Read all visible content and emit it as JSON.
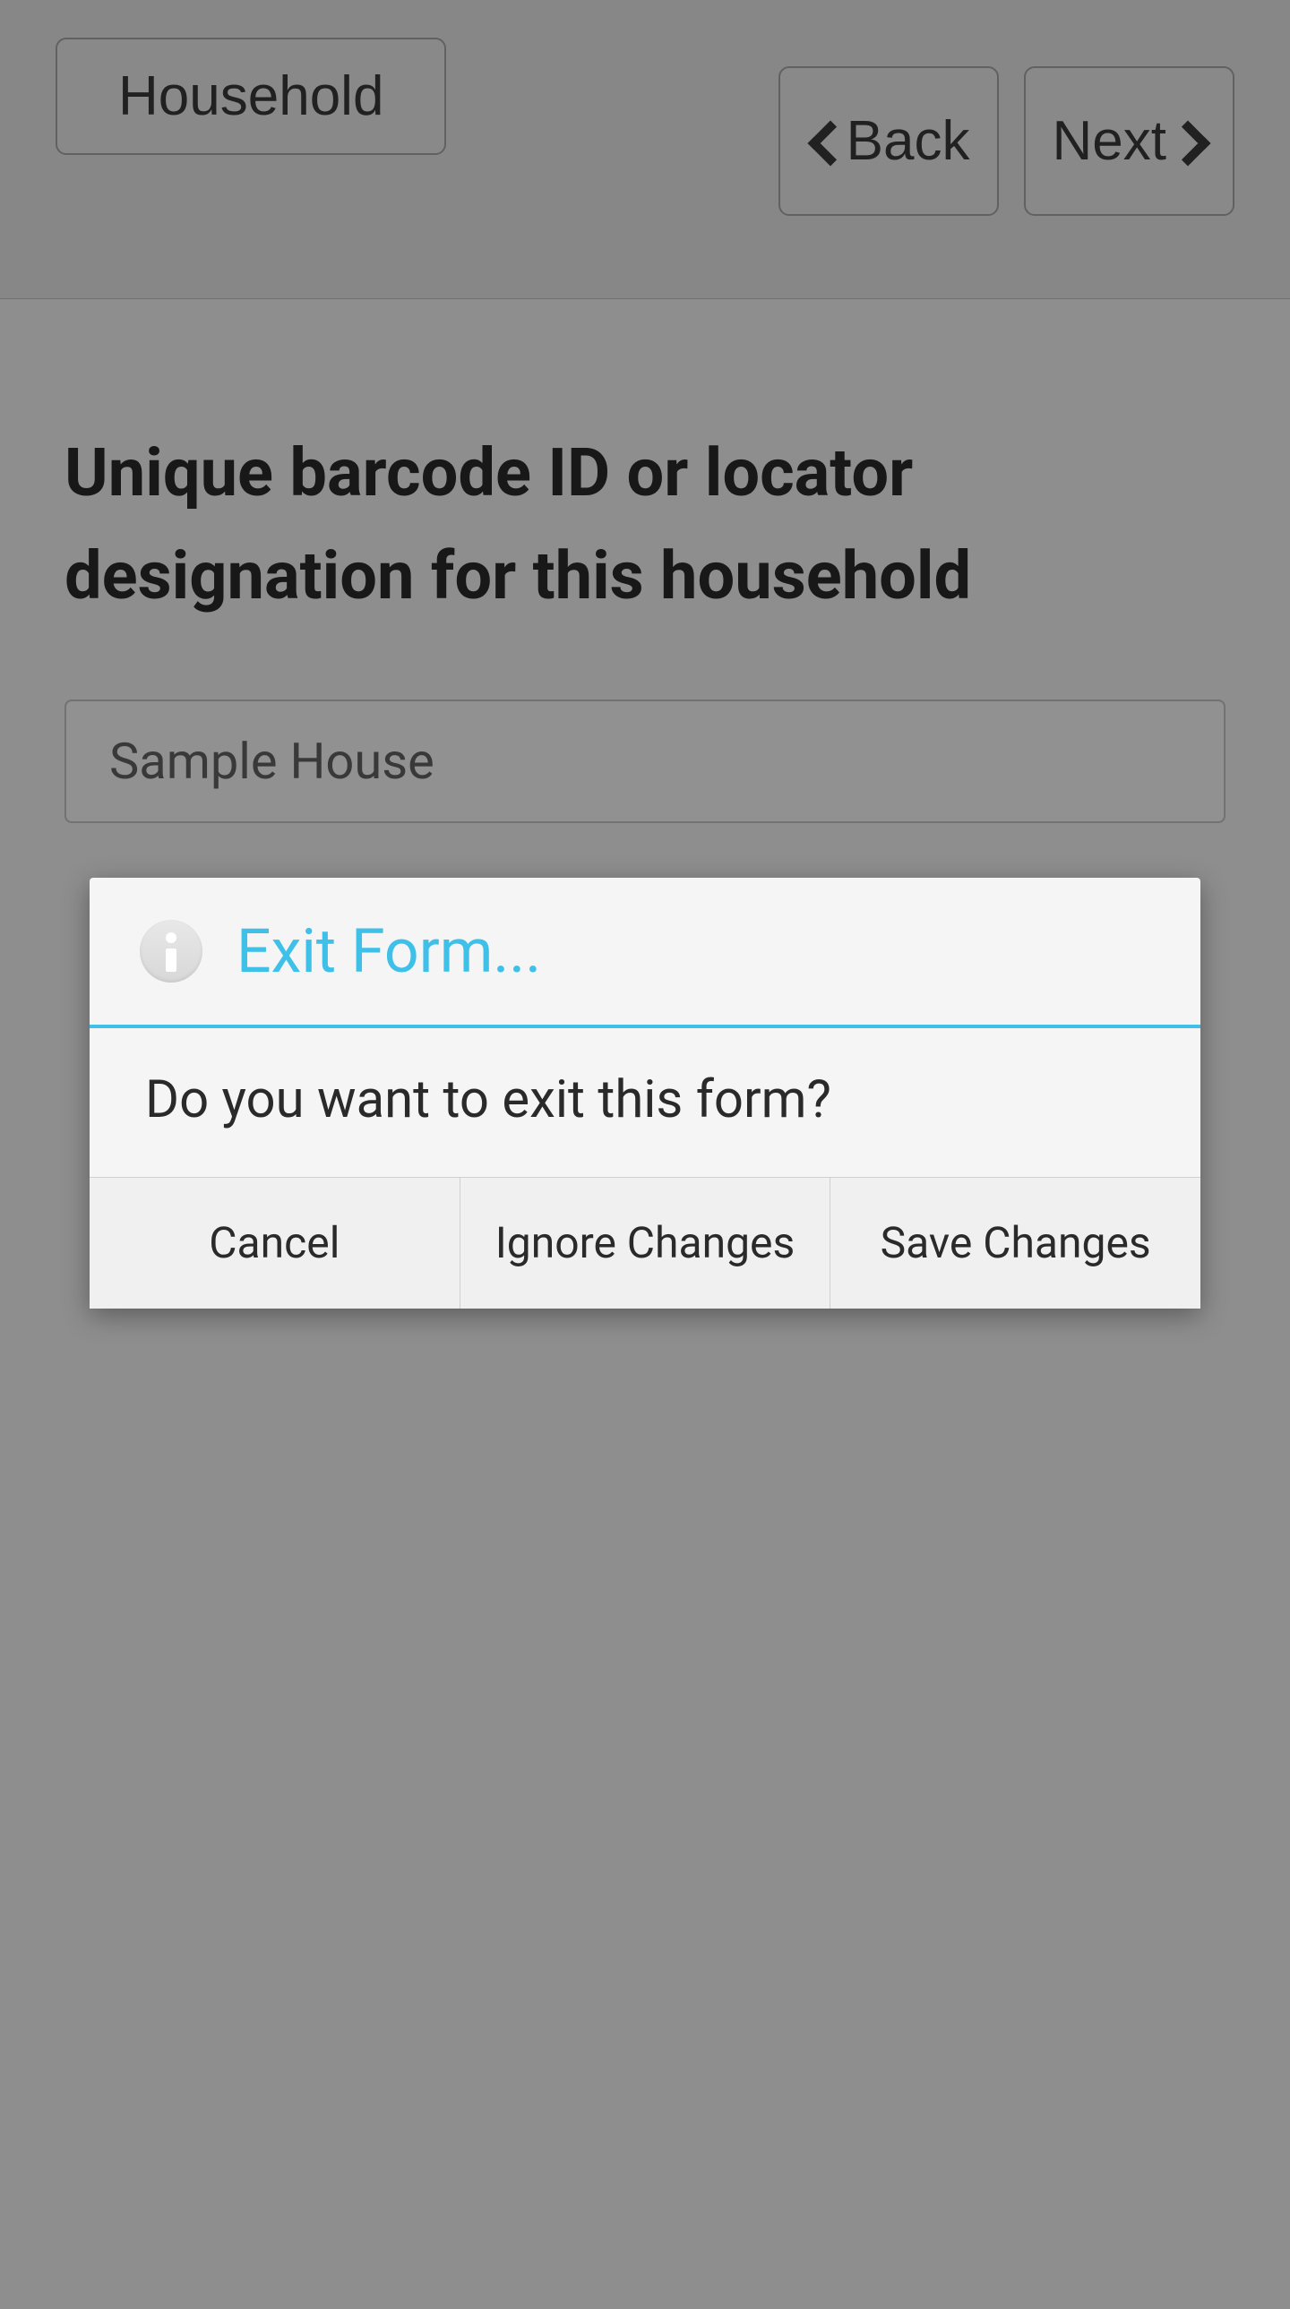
{
  "topbar": {
    "household_label": "Household",
    "back_label": "Back",
    "next_label": "Next"
  },
  "form": {
    "question_title": "Unique barcode ID or locator designation for this household",
    "input_value": "Sample House"
  },
  "dialog": {
    "title": "Exit Form...",
    "message": "Do you want to exit this form?",
    "cancel_label": "Cancel",
    "ignore_label": "Ignore Changes",
    "save_label": "Save Changes"
  }
}
